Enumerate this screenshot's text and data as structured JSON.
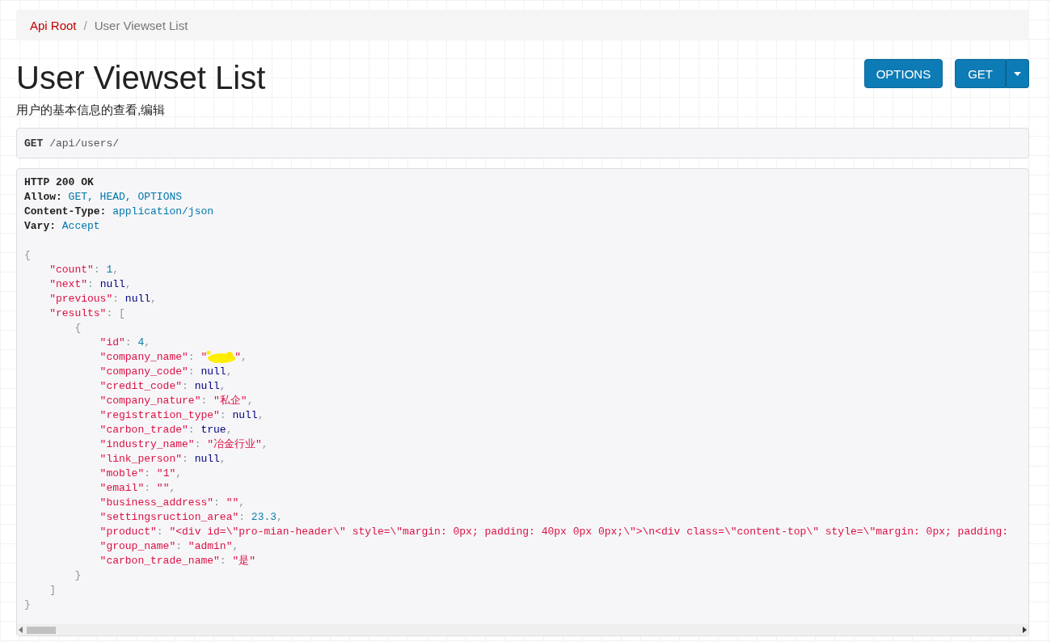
{
  "breadcrumb": [
    {
      "label": "Api Root",
      "selected": false
    },
    {
      "label": "User Viewset List",
      "selected": true
    }
  ],
  "breadcrumb_separator": "/",
  "title": "User Viewset List",
  "buttons": [
    {
      "label": "OPTIONS",
      "kind": "plain"
    },
    {
      "label": "GET",
      "kind": "split"
    }
  ],
  "description": "用户的基本信息的查看,编辑",
  "request": {
    "method": "GET",
    "path": "/api/users/"
  },
  "response": {
    "headers": [
      [
        {
          "text": "HTTP 200 OK",
          "kind": "name"
        }
      ],
      [
        {
          "text": "Allow: ",
          "kind": "name"
        },
        {
          "text": "GET, HEAD, OPTIONS",
          "kind": "value"
        }
      ],
      [
        {
          "text": "Content-Type: ",
          "kind": "name"
        },
        {
          "text": "application/json",
          "kind": "value"
        }
      ],
      [
        {
          "text": "Vary: ",
          "kind": "name"
        },
        {
          "text": "Accept",
          "kind": "value"
        }
      ]
    ],
    "body": [
      {
        "tokens": [
          {
            "text": "{",
            "kind": "punct"
          }
        ],
        "children": [
          {
            "tokens": [
              {
                "text": "\"count\"",
                "kind": "key"
              },
              {
                "text": ": ",
                "kind": "punct"
              },
              {
                "text": "1",
                "kind": "number"
              },
              {
                "text": ",",
                "kind": "punct"
              }
            ]
          },
          {
            "tokens": [
              {
                "text": "\"next\"",
                "kind": "key"
              },
              {
                "text": ": ",
                "kind": "punct"
              },
              {
                "text": "null",
                "kind": "literal"
              },
              {
                "text": ",",
                "kind": "punct"
              }
            ]
          },
          {
            "tokens": [
              {
                "text": "\"previous\"",
                "kind": "key"
              },
              {
                "text": ": ",
                "kind": "punct"
              },
              {
                "text": "null",
                "kind": "literal"
              },
              {
                "text": ",",
                "kind": "punct"
              }
            ]
          },
          {
            "tokens": [
              {
                "text": "\"results\"",
                "kind": "key"
              },
              {
                "text": ": ",
                "kind": "punct"
              },
              {
                "text": "[",
                "kind": "punct"
              }
            ],
            "children": [
              {
                "tokens": [
                  {
                    "text": "{",
                    "kind": "punct"
                  }
                ],
                "children": [
                  {
                    "tokens": [
                      {
                        "text": "\"id\"",
                        "kind": "key"
                      },
                      {
                        "text": ": ",
                        "kind": "punct"
                      },
                      {
                        "text": "4",
                        "kind": "number"
                      },
                      {
                        "text": ",",
                        "kind": "punct"
                      }
                    ]
                  },
                  {
                    "tokens": [
                      {
                        "text": "\"company_name\"",
                        "kind": "key"
                      },
                      {
                        "text": ": ",
                        "kind": "punct"
                      },
                      {
                        "text": "\"",
                        "kind": "string"
                      },
                      {
                        "kind": "redacted"
                      },
                      {
                        "text": "\"",
                        "kind": "string"
                      },
                      {
                        "text": ",",
                        "kind": "punct"
                      }
                    ]
                  },
                  {
                    "tokens": [
                      {
                        "text": "\"company_code\"",
                        "kind": "key"
                      },
                      {
                        "text": ": ",
                        "kind": "punct"
                      },
                      {
                        "text": "null",
                        "kind": "literal"
                      },
                      {
                        "text": ",",
                        "kind": "punct"
                      }
                    ]
                  },
                  {
                    "tokens": [
                      {
                        "text": "\"credit_code\"",
                        "kind": "key"
                      },
                      {
                        "text": ": ",
                        "kind": "punct"
                      },
                      {
                        "text": "null",
                        "kind": "literal"
                      },
                      {
                        "text": ",",
                        "kind": "punct"
                      }
                    ]
                  },
                  {
                    "tokens": [
                      {
                        "text": "\"company_nature\"",
                        "kind": "key"
                      },
                      {
                        "text": ": ",
                        "kind": "punct"
                      },
                      {
                        "text": "\"私企\"",
                        "kind": "string"
                      },
                      {
                        "text": ",",
                        "kind": "punct"
                      }
                    ]
                  },
                  {
                    "tokens": [
                      {
                        "text": "\"registration_type\"",
                        "kind": "key"
                      },
                      {
                        "text": ": ",
                        "kind": "punct"
                      },
                      {
                        "text": "null",
                        "kind": "literal"
                      },
                      {
                        "text": ",",
                        "kind": "punct"
                      }
                    ]
                  },
                  {
                    "tokens": [
                      {
                        "text": "\"carbon_trade\"",
                        "kind": "key"
                      },
                      {
                        "text": ": ",
                        "kind": "punct"
                      },
                      {
                        "text": "true",
                        "kind": "literal"
                      },
                      {
                        "text": ",",
                        "kind": "punct"
                      }
                    ]
                  },
                  {
                    "tokens": [
                      {
                        "text": "\"industry_name\"",
                        "kind": "key"
                      },
                      {
                        "text": ": ",
                        "kind": "punct"
                      },
                      {
                        "text": "\"冶金行业\"",
                        "kind": "string"
                      },
                      {
                        "text": ",",
                        "kind": "punct"
                      }
                    ]
                  },
                  {
                    "tokens": [
                      {
                        "text": "\"link_person\"",
                        "kind": "key"
                      },
                      {
                        "text": ": ",
                        "kind": "punct"
                      },
                      {
                        "text": "null",
                        "kind": "literal"
                      },
                      {
                        "text": ",",
                        "kind": "punct"
                      }
                    ]
                  },
                  {
                    "tokens": [
                      {
                        "text": "\"moble\"",
                        "kind": "key"
                      },
                      {
                        "text": ": ",
                        "kind": "punct"
                      },
                      {
                        "text": "\"1\"",
                        "kind": "string"
                      },
                      {
                        "text": ",",
                        "kind": "punct"
                      }
                    ]
                  },
                  {
                    "tokens": [
                      {
                        "text": "\"email\"",
                        "kind": "key"
                      },
                      {
                        "text": ": ",
                        "kind": "punct"
                      },
                      {
                        "text": "\"\"",
                        "kind": "string"
                      },
                      {
                        "text": ",",
                        "kind": "punct"
                      }
                    ]
                  },
                  {
                    "tokens": [
                      {
                        "text": "\"business_address\"",
                        "kind": "key"
                      },
                      {
                        "text": ": ",
                        "kind": "punct"
                      },
                      {
                        "text": "\"\"",
                        "kind": "string"
                      },
                      {
                        "text": ",",
                        "kind": "punct"
                      }
                    ]
                  },
                  {
                    "tokens": [
                      {
                        "text": "\"settingsruction_area\"",
                        "kind": "key"
                      },
                      {
                        "text": ": ",
                        "kind": "punct"
                      },
                      {
                        "text": "23.3",
                        "kind": "number"
                      },
                      {
                        "text": ",",
                        "kind": "punct"
                      }
                    ]
                  },
                  {
                    "tokens": [
                      {
                        "text": "\"product\"",
                        "kind": "key"
                      },
                      {
                        "text": ": ",
                        "kind": "punct"
                      },
                      {
                        "text": "\"<div id=\\\"pro-mian-header\\\" style=\\\"margin: 0px; padding: 40px 0px 0px;\\\">\\n<div class=\\\"content-top\\\" style=\\\"margin: 0px; padding:",
                        "kind": "string"
                      }
                    ]
                  },
                  {
                    "tokens": [
                      {
                        "text": "\"group_name\"",
                        "kind": "key"
                      },
                      {
                        "text": ": ",
                        "kind": "punct"
                      },
                      {
                        "text": "\"admin\"",
                        "kind": "string"
                      },
                      {
                        "text": ",",
                        "kind": "punct"
                      }
                    ]
                  },
                  {
                    "tokens": [
                      {
                        "text": "\"carbon_trade_name\"",
                        "kind": "key"
                      },
                      {
                        "text": ": ",
                        "kind": "punct"
                      },
                      {
                        "text": "\"是\"",
                        "kind": "string"
                      }
                    ]
                  }
                ]
              },
              {
                "tokens": [
                  {
                    "text": "}",
                    "kind": "punct"
                  }
                ]
              }
            ]
          },
          {
            "tokens": [
              {
                "text": "]",
                "kind": "punct"
              }
            ]
          }
        ]
      },
      {
        "tokens": [
          {
            "text": "}",
            "kind": "punct"
          }
        ]
      }
    ]
  }
}
